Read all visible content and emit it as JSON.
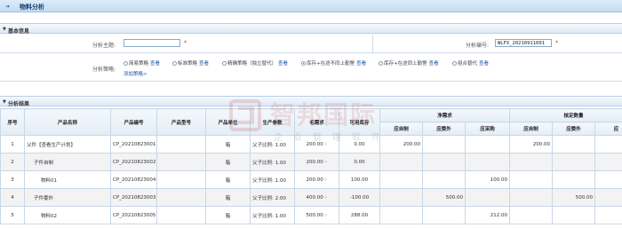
{
  "header": {
    "title": "物料分析"
  },
  "basic": {
    "section_label": "基本信息",
    "subject_label": "分析主题:",
    "subject_value": "",
    "code_label": "分析编号:",
    "code_value": "WLFX_20210911001",
    "strategy_label": "分析策略:",
    "strategies": [
      {
        "label": "简易策略",
        "link": "查看",
        "selected": false
      },
      {
        "label": "标准策略",
        "link": "查看",
        "selected": false
      },
      {
        "label": "精确策略（独立替代）",
        "link": "查看",
        "selected": false
      },
      {
        "label": "库存+在途不同上勤警",
        "link": "查看",
        "selected": true
      },
      {
        "label": "库存+在途同上勤警",
        "link": "查看",
        "selected": false
      },
      {
        "label": "组合替代",
        "link": "查看",
        "selected": false
      }
    ],
    "add_strategy": "添加策略>"
  },
  "results": {
    "section_label": "分析结果",
    "columns": {
      "seq": "序号",
      "name": "产品名称",
      "code": "产品编号",
      "model": "产品型号",
      "unit": "产品单位",
      "ratio": "生产参数",
      "gross": "毛需求",
      "stock": "可用库存",
      "net": "净需求",
      "self": "应自制",
      "outsource": "应委外",
      "purchase": "应采购",
      "confirm": "核定数量",
      "c_self": "应自制",
      "c_out": "应委外",
      "c_pur": "应"
    },
    "rows": [
      {
        "seq": "1",
        "name": "父件【查看生产计划】",
        "code": "CP_20210823001",
        "unit": "箱",
        "ratio": "父子比例: 1.00",
        "gross": "200.00",
        "stock": "0.00",
        "self": "200.00",
        "out": "",
        "pur": "",
        "cself": "200.00",
        "cout": "",
        "cpur": ""
      },
      {
        "seq": "2",
        "name": "子件自制",
        "code": "CP_20210823002",
        "unit": "箱",
        "ratio": "父子比例: 1.00",
        "gross": "200.00",
        "stock": "0.00",
        "self": "",
        "out": "",
        "pur": "",
        "cself": "",
        "cout": "",
        "cpur": ""
      },
      {
        "seq": "3",
        "name": "物料01",
        "code": "CP_20210823004",
        "unit": "箱",
        "ratio": "父子比例: 1.00",
        "gross": "200.00",
        "stock": "100.00",
        "self": "",
        "out": "",
        "pur": "100.00",
        "cself": "",
        "cout": "",
        "cpur": "100"
      },
      {
        "seq": "4",
        "name": "子件委外",
        "code": "CP_20210823003",
        "unit": "箱",
        "ratio": "父子比例: 2.00",
        "gross": "400.00",
        "stock": "-100.00",
        "self": "",
        "out": "500.00",
        "pur": "",
        "cself": "",
        "cout": "500.00",
        "cpur": ""
      },
      {
        "seq": "5",
        "name": "物料02",
        "code": "CP_20210823005",
        "unit": "箱",
        "ratio": "父子比例: 1.00",
        "gross": "500.00",
        "stock": "288.00",
        "self": "",
        "out": "",
        "pur": "212.00",
        "cself": "",
        "cout": "",
        "cpur": "212"
      }
    ]
  },
  "watermark": {
    "big": "智邦国际",
    "small": "企业管理软件"
  }
}
